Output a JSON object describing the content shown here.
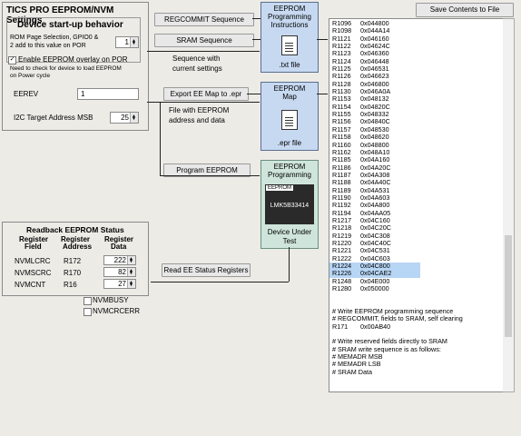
{
  "main_panel": {
    "title": "TICS PRO EEPROM/NVM Settings",
    "startup_heading": "Device start-up behavior",
    "rom_page_label_1": "ROM Page Selection, GPIO0 &",
    "rom_page_label_2": "2 add to this value on POR",
    "rom_page_value": "1",
    "enable_overlay_label": "Enable EEPROM overlay on POR",
    "enable_note_1": "Need to check for device to load EEPROM",
    "enable_note_2": "on Power cycle",
    "eerev_label": "EEREV",
    "eerev_value": "1",
    "i2c_label": "I2C Target Address MSB",
    "i2c_value": "25"
  },
  "buttons": {
    "regcommit": "REGCOMMIT Sequence",
    "sram": "SRAM Sequence",
    "export": "Export EE Map to .epr",
    "program": "Program EEPROM",
    "read_status": "Read EE Status Registers",
    "save": "Save Contents to File"
  },
  "flow_labels": {
    "seq_current_1": "Sequence with",
    "seq_current_2": "current settings",
    "file_eeprom_1": "File with EEPROM",
    "file_eeprom_2": "address and data"
  },
  "boxes": {
    "prog_instr_1": "EEPROM",
    "prog_instr_2": "Programming",
    "prog_instr_3": "Instructions",
    "prog_instr_file": ".txt file",
    "map_1": "EEPROM",
    "map_2": "Map",
    "map_file": ".epr file",
    "dut_1": "EEPROM",
    "dut_2": "Programming",
    "dut_chip_tag": "EEPROM",
    "dut_chip": "LMK5B33414",
    "dut_3": "Device Under",
    "dut_4": "Test"
  },
  "readback": {
    "title": "Readback EEPROM Status",
    "col1a": "Register",
    "col1b": "Field",
    "col2a": "Register",
    "col2b": "Address",
    "col3a": "Register",
    "col3b": "Data",
    "rows": [
      {
        "field": "NVMLCRC",
        "addr": "R172",
        "data": "222"
      },
      {
        "field": "NVMSCRC",
        "addr": "R170",
        "data": "82"
      },
      {
        "field": "NVMCNT",
        "addr": "R16",
        "data": "27"
      }
    ],
    "busy_label": "NVMBUSY",
    "crcerr_label": "NVMCRCERR"
  },
  "listing": {
    "registers": [
      {
        "r": "R1096",
        "v": "0x044800"
      },
      {
        "r": "R1098",
        "v": "0x044A14"
      },
      {
        "r": "R1121",
        "v": "0x046160"
      },
      {
        "r": "R1122",
        "v": "0x04624C"
      },
      {
        "r": "R1123",
        "v": "0x046360"
      },
      {
        "r": "R1124",
        "v": "0x046448"
      },
      {
        "r": "R1125",
        "v": "0x046531"
      },
      {
        "r": "R1126",
        "v": "0x046623"
      },
      {
        "r": "R1128",
        "v": "0x046800"
      },
      {
        "r": "R1130",
        "v": "0x046A0A"
      },
      {
        "r": "R1153",
        "v": "0x048132"
      },
      {
        "r": "R1154",
        "v": "0x04820C"
      },
      {
        "r": "R1155",
        "v": "0x048332"
      },
      {
        "r": "R1156",
        "v": "0x04840C"
      },
      {
        "r": "R1157",
        "v": "0x048530"
      },
      {
        "r": "R1158",
        "v": "0x048620"
      },
      {
        "r": "R1160",
        "v": "0x048800"
      },
      {
        "r": "R1162",
        "v": "0x048A10"
      },
      {
        "r": "R1185",
        "v": "0x04A160"
      },
      {
        "r": "R1186",
        "v": "0x04A20C"
      },
      {
        "r": "R1187",
        "v": "0x04A308"
      },
      {
        "r": "R1188",
        "v": "0x04A40C"
      },
      {
        "r": "R1189",
        "v": "0x04A531"
      },
      {
        "r": "R1190",
        "v": "0x04A603"
      },
      {
        "r": "R1192",
        "v": "0x04A800"
      },
      {
        "r": "R1194",
        "v": "0x04AA05"
      },
      {
        "r": "R1217",
        "v": "0x04C160"
      },
      {
        "r": "R1218",
        "v": "0x04C20C"
      },
      {
        "r": "R1219",
        "v": "0x04C308"
      },
      {
        "r": "R1220",
        "v": "0x04C40C"
      },
      {
        "r": "R1221",
        "v": "0x04C531"
      },
      {
        "r": "R1222",
        "v": "0x04C603"
      },
      {
        "r": "R1224",
        "v": "0x04C800"
      },
      {
        "r": "R1226",
        "v": "0x04CAE2"
      },
      {
        "r": "R1248",
        "v": "0x04E000"
      },
      {
        "r": "R1280",
        "v": "0x050000"
      }
    ],
    "blank": "",
    "c1": "# Write EEPROM programming sequence",
    "c2": "# REGCOMMIT, fields to SRAM, self clearing",
    "r171": "R171",
    "r171v": "0x00AB40",
    "c3": "# Write reserved fields directly to SRAM",
    "c4": "# SRAM write sequence is as follows:",
    "c5": "#    MEMADR MSB",
    "c6": "#    MEMADR LSB",
    "c7": "#    SRAM Data"
  }
}
